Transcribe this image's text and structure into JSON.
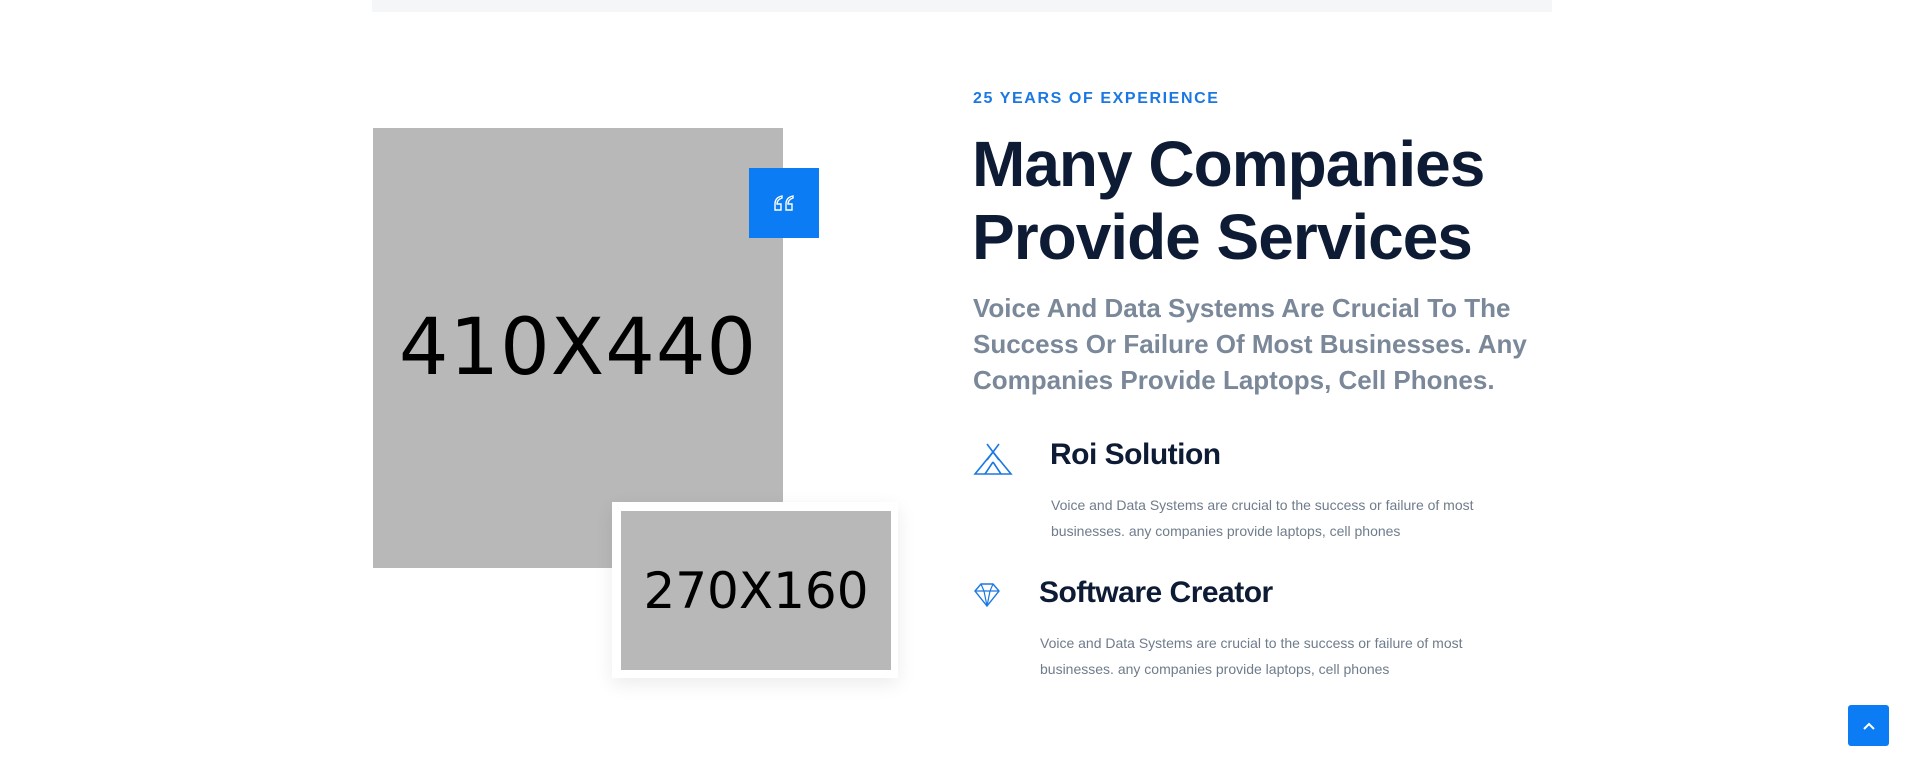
{
  "images": {
    "main_placeholder": "410X440",
    "secondary_placeholder": "270X160"
  },
  "about": {
    "tagline": "25 YEARS OF EXPERIENCE",
    "heading_line1": "Many Companies",
    "heading_line2": "Provide Services",
    "lead": "Voice And Data Systems Are Crucial To The Success Or Failure Of Most Businesses. Any Companies Provide Laptops, Cell Phones."
  },
  "features": [
    {
      "icon": "tent-icon",
      "title": "Roi Solution",
      "text": "Voice and Data Systems are crucial to the success or failure of most businesses. any companies provide laptops, cell phones"
    },
    {
      "icon": "diamond-icon",
      "title": "Software Creator",
      "text": "Voice and Data Systems are crucial to the success or failure of most businesses. any companies provide laptops, cell phones"
    }
  ],
  "colors": {
    "accent": "#0b7cf3",
    "heading": "#0e1b34",
    "muted": "#7a8899"
  },
  "controls": {
    "quote_icon": "quote-icon",
    "scroll_top_icon": "chevron-up-icon"
  }
}
